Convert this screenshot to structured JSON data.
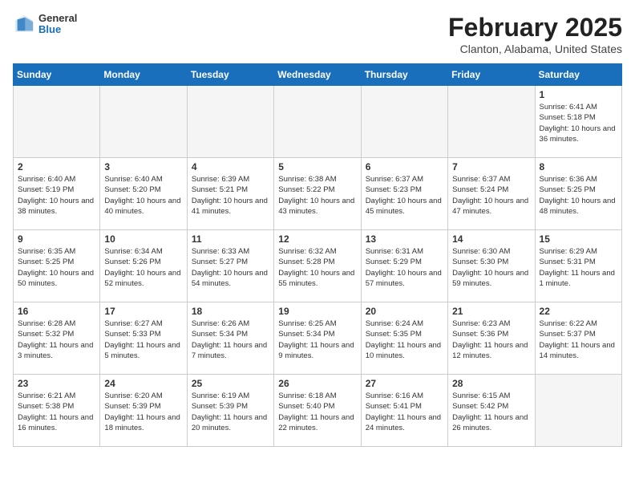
{
  "header": {
    "logo": {
      "general": "General",
      "blue": "Blue"
    },
    "month": "February 2025",
    "location": "Clanton, Alabama, United States"
  },
  "weekdays": [
    "Sunday",
    "Monday",
    "Tuesday",
    "Wednesday",
    "Thursday",
    "Friday",
    "Saturday"
  ],
  "weeks": [
    [
      {
        "day": "",
        "info": ""
      },
      {
        "day": "",
        "info": ""
      },
      {
        "day": "",
        "info": ""
      },
      {
        "day": "",
        "info": ""
      },
      {
        "day": "",
        "info": ""
      },
      {
        "day": "",
        "info": ""
      },
      {
        "day": "1",
        "info": "Sunrise: 6:41 AM\nSunset: 5:18 PM\nDaylight: 10 hours and 36 minutes."
      }
    ],
    [
      {
        "day": "2",
        "info": "Sunrise: 6:40 AM\nSunset: 5:19 PM\nDaylight: 10 hours and 38 minutes."
      },
      {
        "day": "3",
        "info": "Sunrise: 6:40 AM\nSunset: 5:20 PM\nDaylight: 10 hours and 40 minutes."
      },
      {
        "day": "4",
        "info": "Sunrise: 6:39 AM\nSunset: 5:21 PM\nDaylight: 10 hours and 41 minutes."
      },
      {
        "day": "5",
        "info": "Sunrise: 6:38 AM\nSunset: 5:22 PM\nDaylight: 10 hours and 43 minutes."
      },
      {
        "day": "6",
        "info": "Sunrise: 6:37 AM\nSunset: 5:23 PM\nDaylight: 10 hours and 45 minutes."
      },
      {
        "day": "7",
        "info": "Sunrise: 6:37 AM\nSunset: 5:24 PM\nDaylight: 10 hours and 47 minutes."
      },
      {
        "day": "8",
        "info": "Sunrise: 6:36 AM\nSunset: 5:25 PM\nDaylight: 10 hours and 48 minutes."
      }
    ],
    [
      {
        "day": "9",
        "info": "Sunrise: 6:35 AM\nSunset: 5:25 PM\nDaylight: 10 hours and 50 minutes."
      },
      {
        "day": "10",
        "info": "Sunrise: 6:34 AM\nSunset: 5:26 PM\nDaylight: 10 hours and 52 minutes."
      },
      {
        "day": "11",
        "info": "Sunrise: 6:33 AM\nSunset: 5:27 PM\nDaylight: 10 hours and 54 minutes."
      },
      {
        "day": "12",
        "info": "Sunrise: 6:32 AM\nSunset: 5:28 PM\nDaylight: 10 hours and 55 minutes."
      },
      {
        "day": "13",
        "info": "Sunrise: 6:31 AM\nSunset: 5:29 PM\nDaylight: 10 hours and 57 minutes."
      },
      {
        "day": "14",
        "info": "Sunrise: 6:30 AM\nSunset: 5:30 PM\nDaylight: 10 hours and 59 minutes."
      },
      {
        "day": "15",
        "info": "Sunrise: 6:29 AM\nSunset: 5:31 PM\nDaylight: 11 hours and 1 minute."
      }
    ],
    [
      {
        "day": "16",
        "info": "Sunrise: 6:28 AM\nSunset: 5:32 PM\nDaylight: 11 hours and 3 minutes."
      },
      {
        "day": "17",
        "info": "Sunrise: 6:27 AM\nSunset: 5:33 PM\nDaylight: 11 hours and 5 minutes."
      },
      {
        "day": "18",
        "info": "Sunrise: 6:26 AM\nSunset: 5:34 PM\nDaylight: 11 hours and 7 minutes."
      },
      {
        "day": "19",
        "info": "Sunrise: 6:25 AM\nSunset: 5:34 PM\nDaylight: 11 hours and 9 minutes."
      },
      {
        "day": "20",
        "info": "Sunrise: 6:24 AM\nSunset: 5:35 PM\nDaylight: 11 hours and 10 minutes."
      },
      {
        "day": "21",
        "info": "Sunrise: 6:23 AM\nSunset: 5:36 PM\nDaylight: 11 hours and 12 minutes."
      },
      {
        "day": "22",
        "info": "Sunrise: 6:22 AM\nSunset: 5:37 PM\nDaylight: 11 hours and 14 minutes."
      }
    ],
    [
      {
        "day": "23",
        "info": "Sunrise: 6:21 AM\nSunset: 5:38 PM\nDaylight: 11 hours and 16 minutes."
      },
      {
        "day": "24",
        "info": "Sunrise: 6:20 AM\nSunset: 5:39 PM\nDaylight: 11 hours and 18 minutes."
      },
      {
        "day": "25",
        "info": "Sunrise: 6:19 AM\nSunset: 5:39 PM\nDaylight: 11 hours and 20 minutes."
      },
      {
        "day": "26",
        "info": "Sunrise: 6:18 AM\nSunset: 5:40 PM\nDaylight: 11 hours and 22 minutes."
      },
      {
        "day": "27",
        "info": "Sunrise: 6:16 AM\nSunset: 5:41 PM\nDaylight: 11 hours and 24 minutes."
      },
      {
        "day": "28",
        "info": "Sunrise: 6:15 AM\nSunset: 5:42 PM\nDaylight: 11 hours and 26 minutes."
      },
      {
        "day": "",
        "info": ""
      }
    ]
  ]
}
